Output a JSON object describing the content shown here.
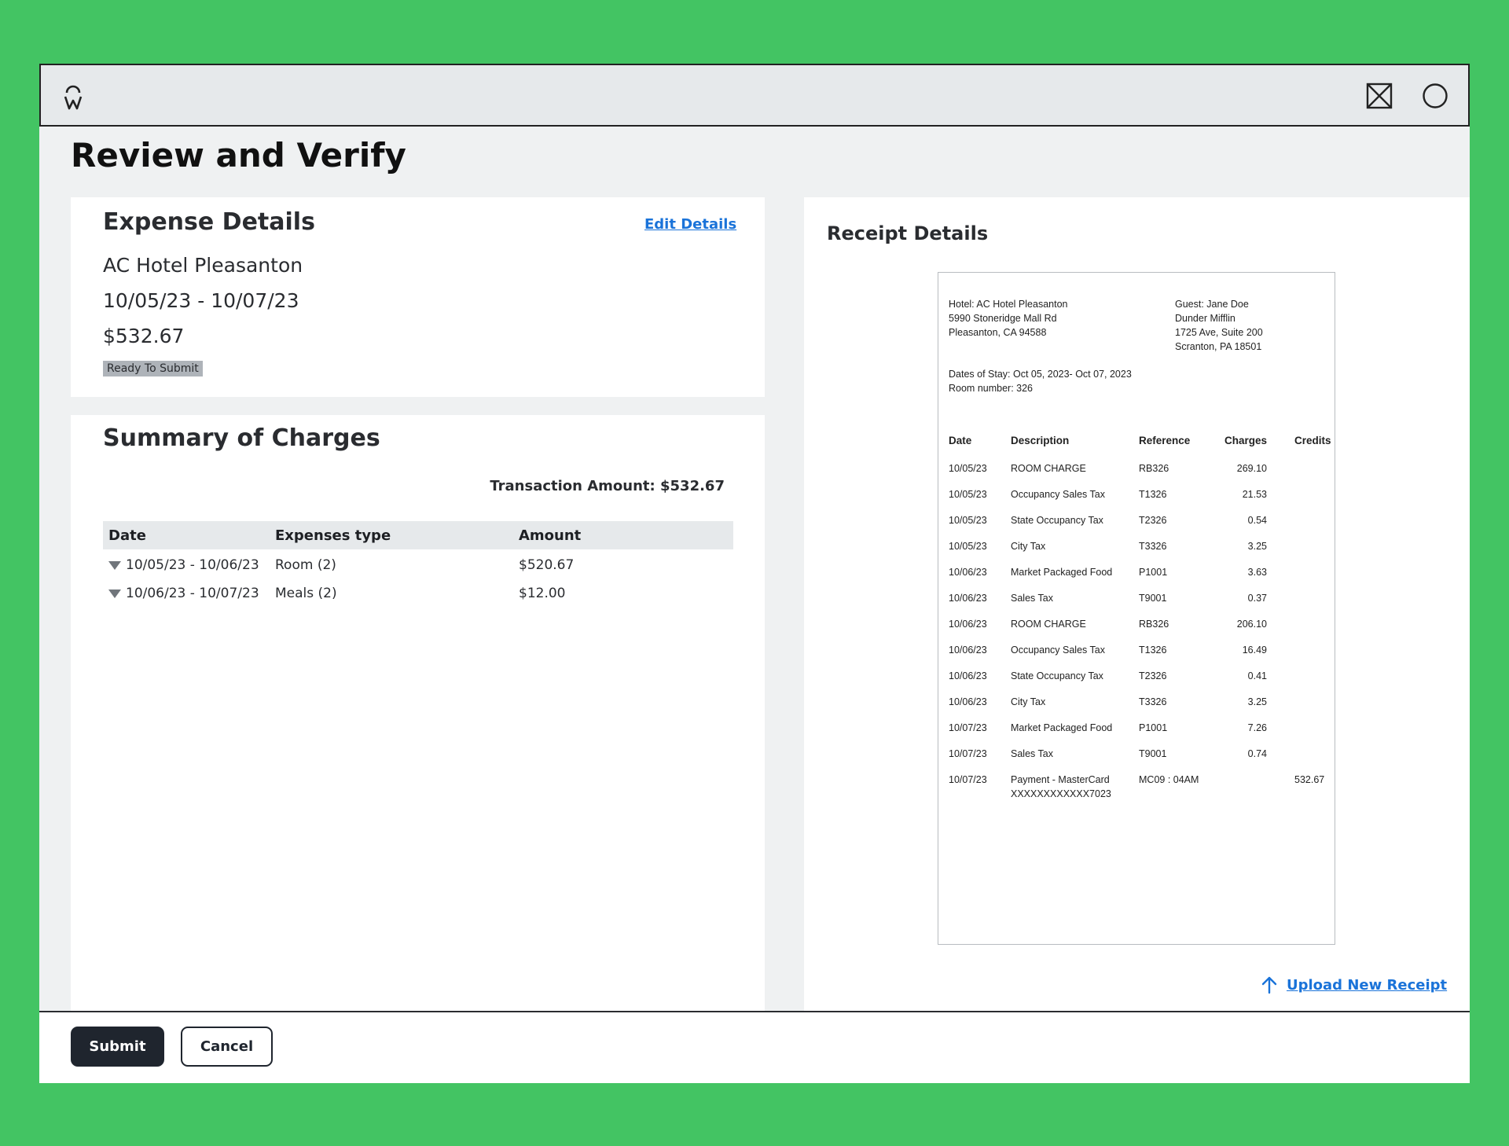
{
  "header": {
    "logo_icon": "w-logo-icon",
    "close_icon": "close-box-icon",
    "circle_icon": "circle-icon"
  },
  "page_title": "Review and Verify",
  "expense": {
    "heading": "Expense Details",
    "edit_label": "Edit Details",
    "merchant": "AC Hotel Pleasanton",
    "dates": "10/05/23 - 10/07/23",
    "amount": "$532.67",
    "status": "Ready To Submit"
  },
  "summary": {
    "heading": "Summary of Charges",
    "transaction_label": "Transaction Amount: $532.67",
    "columns": [
      "Date",
      "Expenses type",
      "Amount"
    ],
    "rows": [
      {
        "date": "10/05/23 - 10/06/23",
        "type": "Room (2)",
        "amount": "$520.67"
      },
      {
        "date": "10/06/23 - 10/07/23",
        "type": "Meals (2)",
        "amount": "$12.00"
      }
    ]
  },
  "receipt": {
    "heading": "Receipt Details",
    "hotel_lines": [
      "Hotel: AC Hotel Pleasanton",
      "5990 Stoneridge Mall Rd",
      "Pleasanton, CA 94588"
    ],
    "guest_lines": [
      "Guest: Jane Doe",
      "Dunder Mifflin",
      "1725 Ave, Suite 200",
      "Scranton, PA 18501"
    ],
    "stay_lines": [
      "Dates of Stay: Oct 05, 2023- Oct 07, 2023",
      "Room number: 326"
    ],
    "columns": [
      "Date",
      "Description",
      "Reference",
      "Charges",
      "Credits"
    ],
    "rows": [
      {
        "date": "10/05/23",
        "desc": "ROOM CHARGE",
        "desc2": "",
        "ref": "RB326",
        "charges": "269.10",
        "credits": ""
      },
      {
        "date": "10/05/23",
        "desc": "Occupancy Sales Tax",
        "desc2": "",
        "ref": "T1326",
        "charges": "21.53",
        "credits": ""
      },
      {
        "date": "10/05/23",
        "desc": "State Occupancy Tax",
        "desc2": "",
        "ref": "T2326",
        "charges": "0.54",
        "credits": ""
      },
      {
        "date": "10/05/23",
        "desc": "City Tax",
        "desc2": "",
        "ref": "T3326",
        "charges": "3.25",
        "credits": ""
      },
      {
        "date": "10/06/23",
        "desc": "Market Packaged Food",
        "desc2": "",
        "ref": "P1001",
        "charges": "3.63",
        "credits": ""
      },
      {
        "date": "10/06/23",
        "desc": "Sales Tax",
        "desc2": "",
        "ref": "T9001",
        "charges": "0.37",
        "credits": ""
      },
      {
        "date": "10/06/23",
        "desc": "ROOM CHARGE",
        "desc2": "",
        "ref": "RB326",
        "charges": "206.10",
        "credits": ""
      },
      {
        "date": "10/06/23",
        "desc": "Occupancy Sales Tax",
        "desc2": "",
        "ref": "T1326",
        "charges": "16.49",
        "credits": ""
      },
      {
        "date": "10/06/23",
        "desc": "State Occupancy Tax",
        "desc2": "",
        "ref": "T2326",
        "charges": "0.41",
        "credits": ""
      },
      {
        "date": "10/06/23",
        "desc": "City Tax",
        "desc2": "",
        "ref": "T3326",
        "charges": "3.25",
        "credits": ""
      },
      {
        "date": "10/07/23",
        "desc": "Market Packaged Food",
        "desc2": "",
        "ref": "P1001",
        "charges": "7.26",
        "credits": ""
      },
      {
        "date": "10/07/23",
        "desc": "Sales Tax",
        "desc2": "",
        "ref": "T9001",
        "charges": "0.74",
        "credits": ""
      },
      {
        "date": "10/07/23",
        "desc": "Payment - MasterCard",
        "desc2": "XXXXXXXXXXXX7023",
        "ref": "MC09 : 04AM",
        "charges": "",
        "credits": "532.67"
      }
    ],
    "upload_label": "Upload New Receipt",
    "upload_icon": "arrow-up-icon"
  },
  "footer": {
    "submit_label": "Submit",
    "cancel_label": "Cancel"
  }
}
